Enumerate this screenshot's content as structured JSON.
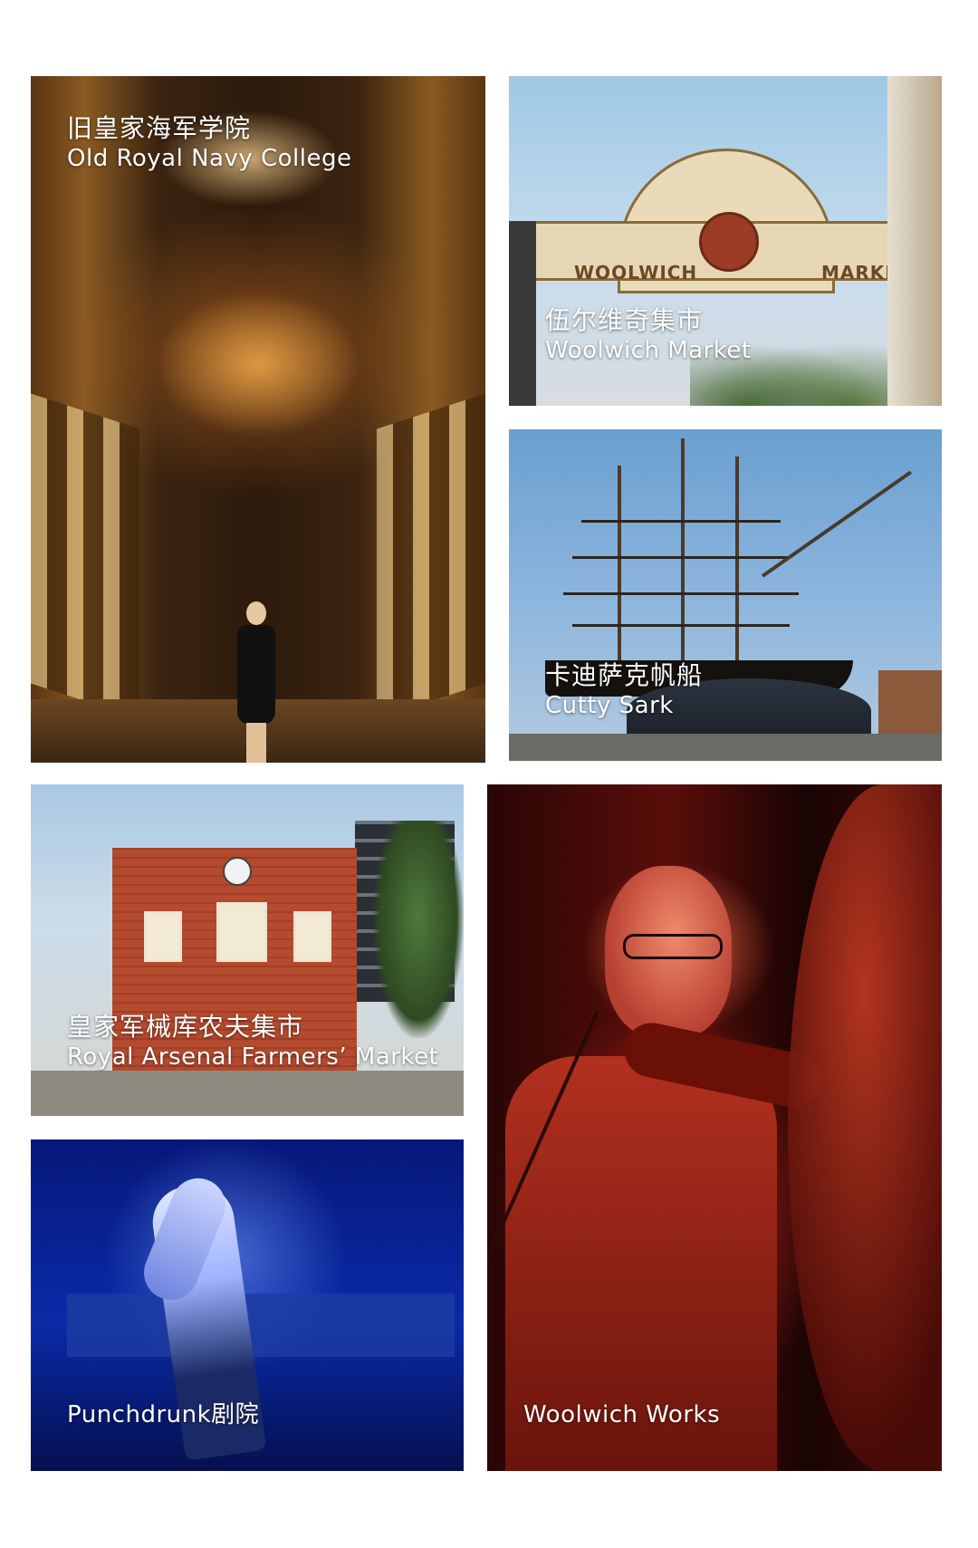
{
  "tiles": [
    {
      "zh": "旧皇家海军学院",
      "en": "Old Royal Navy College"
    },
    {
      "zh": "伍尔维奇集市",
      "en": "Woolwich Market"
    },
    {
      "zh": "卡迪萨克帆船",
      "en": "Cutty Sark"
    },
    {
      "zh": "皇家军械库农夫集市",
      "en": "Royal Arsenal Farmers’ Market"
    },
    {
      "zh": "",
      "en": "Punchdrunk剧院"
    },
    {
      "zh": "",
      "en": "Woolwich Works"
    }
  ],
  "signage": {
    "market_left": "WOOLWICH",
    "market_right": "MARKET"
  }
}
